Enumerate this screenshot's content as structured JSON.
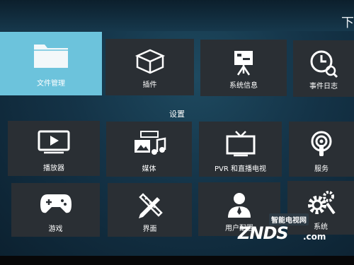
{
  "header": {
    "corner_char": "下"
  },
  "row1": [
    {
      "label": "文件管理",
      "icon": "folder-icon",
      "active": true
    },
    {
      "label": "插件",
      "icon": "box-icon"
    },
    {
      "label": "系统信息",
      "icon": "presentation-icon"
    },
    {
      "label": "事件日志",
      "icon": "clock-search-icon"
    }
  ],
  "settings": {
    "title": "设置",
    "items": [
      {
        "label": "播放器",
        "icon": "play-screen-icon"
      },
      {
        "label": "媒体",
        "icon": "media-icon"
      },
      {
        "label": "PVR 和直播电视",
        "icon": "tv-icon"
      },
      {
        "label": "服务",
        "icon": "podcast-icon"
      },
      {
        "label": "游戏",
        "icon": "gamepad-icon"
      },
      {
        "label": "界面",
        "icon": "pencil-ruler-icon"
      },
      {
        "label": "用户配置",
        "icon": "user-icon"
      },
      {
        "label": "系统",
        "icon": "gears-icon"
      }
    ]
  },
  "watermark": {
    "top": "智能电视网",
    "main": "ZNDS",
    "suffix": ".com"
  },
  "colors": {
    "active_tile": "#6cc3dc",
    "tile": "#2a2f34",
    "background": "#143347"
  }
}
